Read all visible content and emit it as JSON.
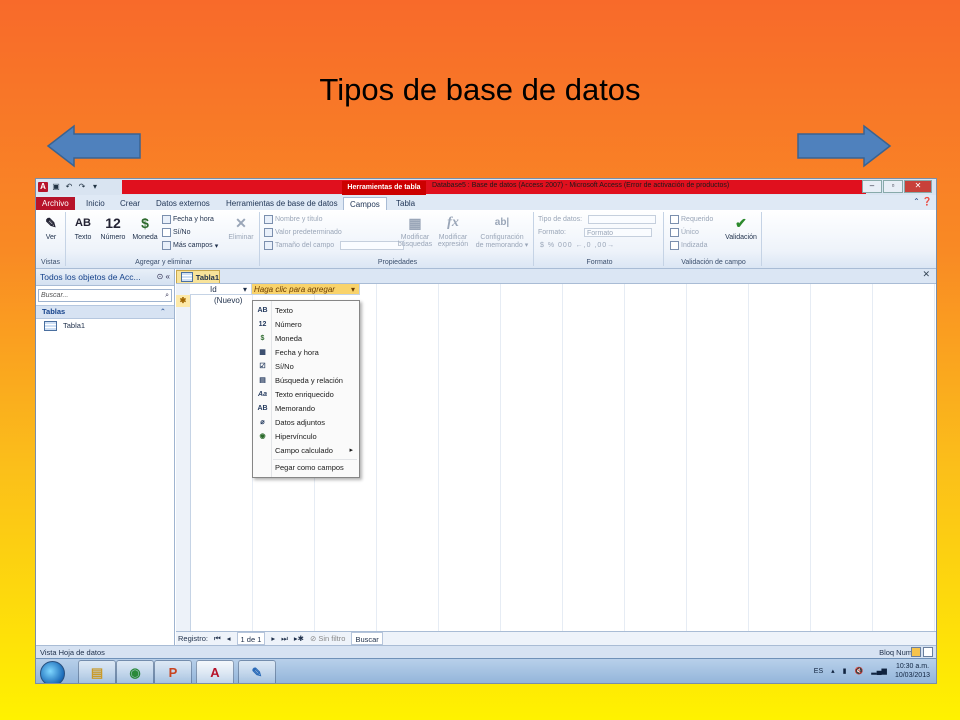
{
  "slide": {
    "title": "Tipos de base de datos"
  },
  "window": {
    "app_icon": "A",
    "contextual_tab": "Herramientas de tabla",
    "title": "Database5 : Base de datos (Access 2007) - Microsoft Access (Error de activación de productos)",
    "controls": {
      "minimize": "–",
      "restore": "▫",
      "close": "✕"
    }
  },
  "tabs": [
    "Archivo",
    "Inicio",
    "Crear",
    "Datos externos",
    "Herramientas de base de datos",
    "Campos",
    "Tabla"
  ],
  "ribbon": {
    "vistas": {
      "ver": "Ver",
      "label": "Vistas"
    },
    "agregar": {
      "texto": "Texto",
      "numero": "Número",
      "moneda": "Moneda",
      "fecha": "Fecha y hora",
      "sino": "Sí/No",
      "mas": "Más campos",
      "eliminar": "Eliminar",
      "label": "Agregar y eliminar"
    },
    "propiedades": {
      "nombre": "Nombre y título",
      "valor": "Valor predeterminado",
      "tamano": "Tamaño del campo",
      "modificar_busquedas": [
        "Modificar",
        "búsquedas"
      ],
      "modificar_expresion": [
        "Modificar",
        "expresión"
      ],
      "configuracion": [
        "Configuración",
        "de memorando"
      ],
      "label": "Propiedades"
    },
    "formato": {
      "tipo": "Tipo de datos:",
      "formato": "Formato:",
      "formato_val": "Formato",
      "symbols": "$  %  000   ←,0  ,00→",
      "label": "Formato"
    },
    "validacion": {
      "requerido": "Requerido",
      "unico": "Único",
      "indizada": "Indizada",
      "validacion": "Validación",
      "label": "Validación de campo"
    }
  },
  "nav": {
    "header": "Todos los objetos de Acc...",
    "search_placeholder": "Buscar...",
    "group": "Tablas",
    "items": [
      "Tabla1"
    ]
  },
  "doc": {
    "tab": "Tabla1",
    "col_id": "Id",
    "col_add": "Haga clic para agregar",
    "new_row": "(Nuevo)"
  },
  "menu": {
    "items": [
      {
        "icon": "AB",
        "label": "Texto"
      },
      {
        "icon": "12",
        "label": "Número"
      },
      {
        "icon": "$",
        "label": "Moneda"
      },
      {
        "icon": "▦",
        "label": "Fecha y hora"
      },
      {
        "icon": "☑",
        "label": "Sí/No"
      },
      {
        "icon": "▤",
        "label": "Búsqueda y relación"
      },
      {
        "icon": "Aa",
        "label": "Texto enriquecido"
      },
      {
        "icon": "AB",
        "label": "Memorando"
      },
      {
        "icon": "⌀",
        "label": "Datos adjuntos"
      },
      {
        "icon": "◉",
        "label": "Hipervínculo"
      },
      {
        "icon": "",
        "label": "Campo calculado"
      },
      {
        "icon": "",
        "label": "Pegar como campos"
      }
    ]
  },
  "recnav": {
    "label": "Registro:",
    "position": "1 de 1",
    "filter": "Sin filtro",
    "search": "Buscar"
  },
  "status": {
    "left": "Vista Hoja de datos",
    "right": "Bloq Num"
  },
  "taskbar": {
    "lang": "ES",
    "time": "10:30 a.m.",
    "date": "10/03/2013",
    "apps": [
      {
        "icon": "folder-icon",
        "glyph": "▤"
      },
      {
        "icon": "chrome-icon",
        "glyph": "◉"
      },
      {
        "icon": "powerpoint-icon",
        "glyph": "P"
      },
      {
        "icon": "access-icon",
        "glyph": "A"
      },
      {
        "icon": "paint-icon",
        "glyph": "✎"
      }
    ]
  },
  "colors": {
    "access_red": "#b7132a",
    "context_red": "#e0101e",
    "arrow_blue": "#4f81bd"
  }
}
